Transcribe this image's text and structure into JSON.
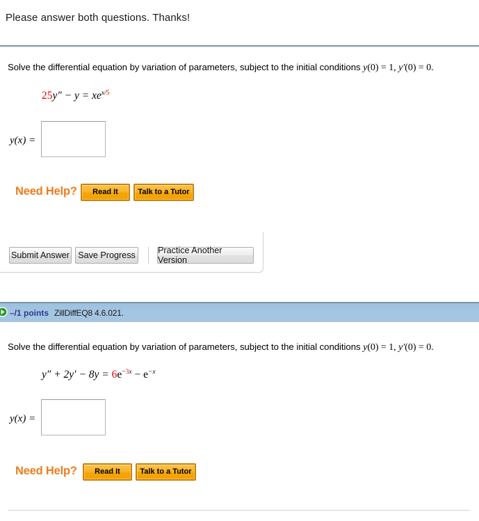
{
  "header": {
    "note": "Please answer both questions. Thanks!"
  },
  "questions": [
    {
      "prompt_before": "Solve the differential equation by variation of parameters, subject to the initial conditions ",
      "cond1_fn": "y",
      "cond1_arg": "(0) = 1, ",
      "cond2_fn": "y",
      "cond2_prime": "′",
      "cond2_arg": "(0) = 0.",
      "equation": {
        "coef": "25",
        "coef_color": "#ee0000",
        "body": "y″ − y = xe",
        "exp_num": "x/",
        "exp_den": "5",
        "exp_den_color": "#ee0000"
      },
      "answer": {
        "label_fn": "y",
        "label_rest": "(x) =",
        "value": "",
        "placeholder": ""
      },
      "help": {
        "title": "Need Help?",
        "buttons": [
          "Read It",
          "Talk to a Tutor"
        ]
      },
      "actions": {
        "buttons": [
          "Submit Answer",
          "Save Progress"
        ],
        "practice": "Practice Another Version"
      }
    },
    {
      "bar": {
        "icon": "green-arrow-icon",
        "points": "–/1 points",
        "question_id": "ZillDiffEQ8 4.6.021."
      },
      "prompt_before": "Solve the differential equation by variation of parameters, subject to the initial conditions ",
      "cond1_fn": "y",
      "cond1_arg": "(0) = 1, ",
      "cond2_fn": "y",
      "cond2_prime": "′",
      "cond2_arg": "(0) = 0.",
      "equation": {
        "lhs": "y″ + 2y′ − 8y = ",
        "coef": "6",
        "coef_color": "#ee0000",
        "e1": "e",
        "e1_exp_sign": "−",
        "e1_exp_num": "3",
        "e1_exp_num_color": "#ee0000",
        "e1_exp_var": "x",
        "mid": " − ",
        "e2": "e",
        "e2_exp": "−x"
      },
      "answer": {
        "label_fn": "y",
        "label_rest": "(x) =",
        "value": "",
        "placeholder": ""
      },
      "help": {
        "title": "Need Help?",
        "buttons": [
          "Read It",
          "Talk to a Tutor"
        ]
      }
    }
  ],
  "colors": {
    "rule": "#7d94ab",
    "bar_bg": "#a3c5e1",
    "points_text": "#2b3a8f",
    "orange": "#f07c1c",
    "red": "#ee0000"
  }
}
